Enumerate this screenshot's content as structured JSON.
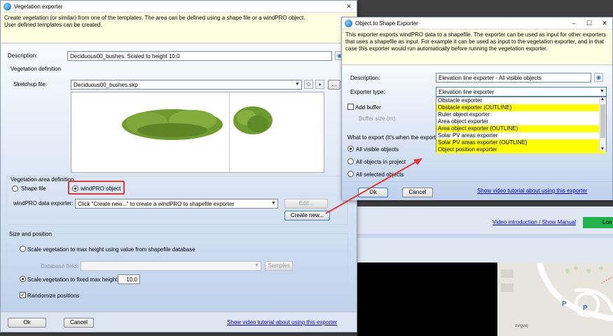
{
  "background": {
    "video_link": "Video introduction / Show Manual",
    "load_label": "Loa",
    "road_label": "ovigvej"
  },
  "veg": {
    "title": "Vegetation exporter",
    "info": "Create vegetation (or similar) from one of the templates. The area can be defined using a shape file or a windPRO object.\nUser defined templates can be created.",
    "description_label": "Description:",
    "description_value": "Deciduous00_bushes. Scaled to height 10.0",
    "definition_title": "Vegetation definition",
    "sketchup_label": "Sketchup file:",
    "sketchup_value": "Deciduous00_bushes.skp",
    "browse_label": "...",
    "area_title": "Vegetation area definition",
    "shape_file_label": "Shape file",
    "windpro_object_label": "windPRO object",
    "data_exporter_label": "windPRO data exporter:",
    "data_exporter_value": "Click \"Create new...\" to create a windPRO to shapefile exporter",
    "edit_label": "Edit...",
    "create_new_label": "Create new...",
    "size_title": "Size and position",
    "scale_db_label": "Scale vegetation to max height using value from shapefile database",
    "database_field_label": "Database field:",
    "samples_label": "Samples",
    "scale_fixed_label": "Scale vegetation to fixed max height",
    "fixed_height_value": "10.0",
    "randomize_label": "Randomize positions",
    "ok_label": "Ok",
    "cancel_label": "Cancel",
    "video_link": "Show video tutorial about using this exporter"
  },
  "obj": {
    "title": "Object to Shape Exporter",
    "info": "This exporter exports windPRO data to a shapefile. The exporter can be used as input for other exporters that uses a shapefile as input. For example it can be used as input to the vegetation exporter, and in that case this exporter would run automatically before running the vegetation exporter.",
    "description_label": "Description:",
    "description_value": "Elevation line exporter - All visible objects",
    "exporter_type_label": "Exporter type:",
    "exporter_type_value": "Elevation line exporter",
    "add_buffer_label": "Add buffer",
    "buffer_size_label": "Buffer size (m):",
    "what_to_export_label": "What to export  (It's when the export",
    "all_visible_label": "All visible objects",
    "all_in_project_label": "All objects in project",
    "all_selected_label": "All selected objects",
    "ok_label": "Ok",
    "cancel_label": "Cancel",
    "video_link": "Show video tutorial about using this exporter",
    "dropdown_items": [
      {
        "label": "Obstacle exporter",
        "highlighted": false
      },
      {
        "label": "Obstacle exporter (OUTLINE)",
        "highlighted": true
      },
      {
        "label": "Ruler object exporter",
        "highlighted": false
      },
      {
        "label": "Area object exporter",
        "highlighted": false
      },
      {
        "label": "Area object exporter (OUTLINE)",
        "highlighted": true
      },
      {
        "label": "Solar PV areas exporter",
        "highlighted": false
      },
      {
        "label": "Solar PV areas exporter (OUTLINE)",
        "highlighted": true
      },
      {
        "label": "Object position exporter",
        "highlighted": true
      }
    ]
  },
  "colors": {
    "highlight": "#ffff00",
    "annotation_red": "#e03a3a",
    "load_green": "#21b24b"
  }
}
